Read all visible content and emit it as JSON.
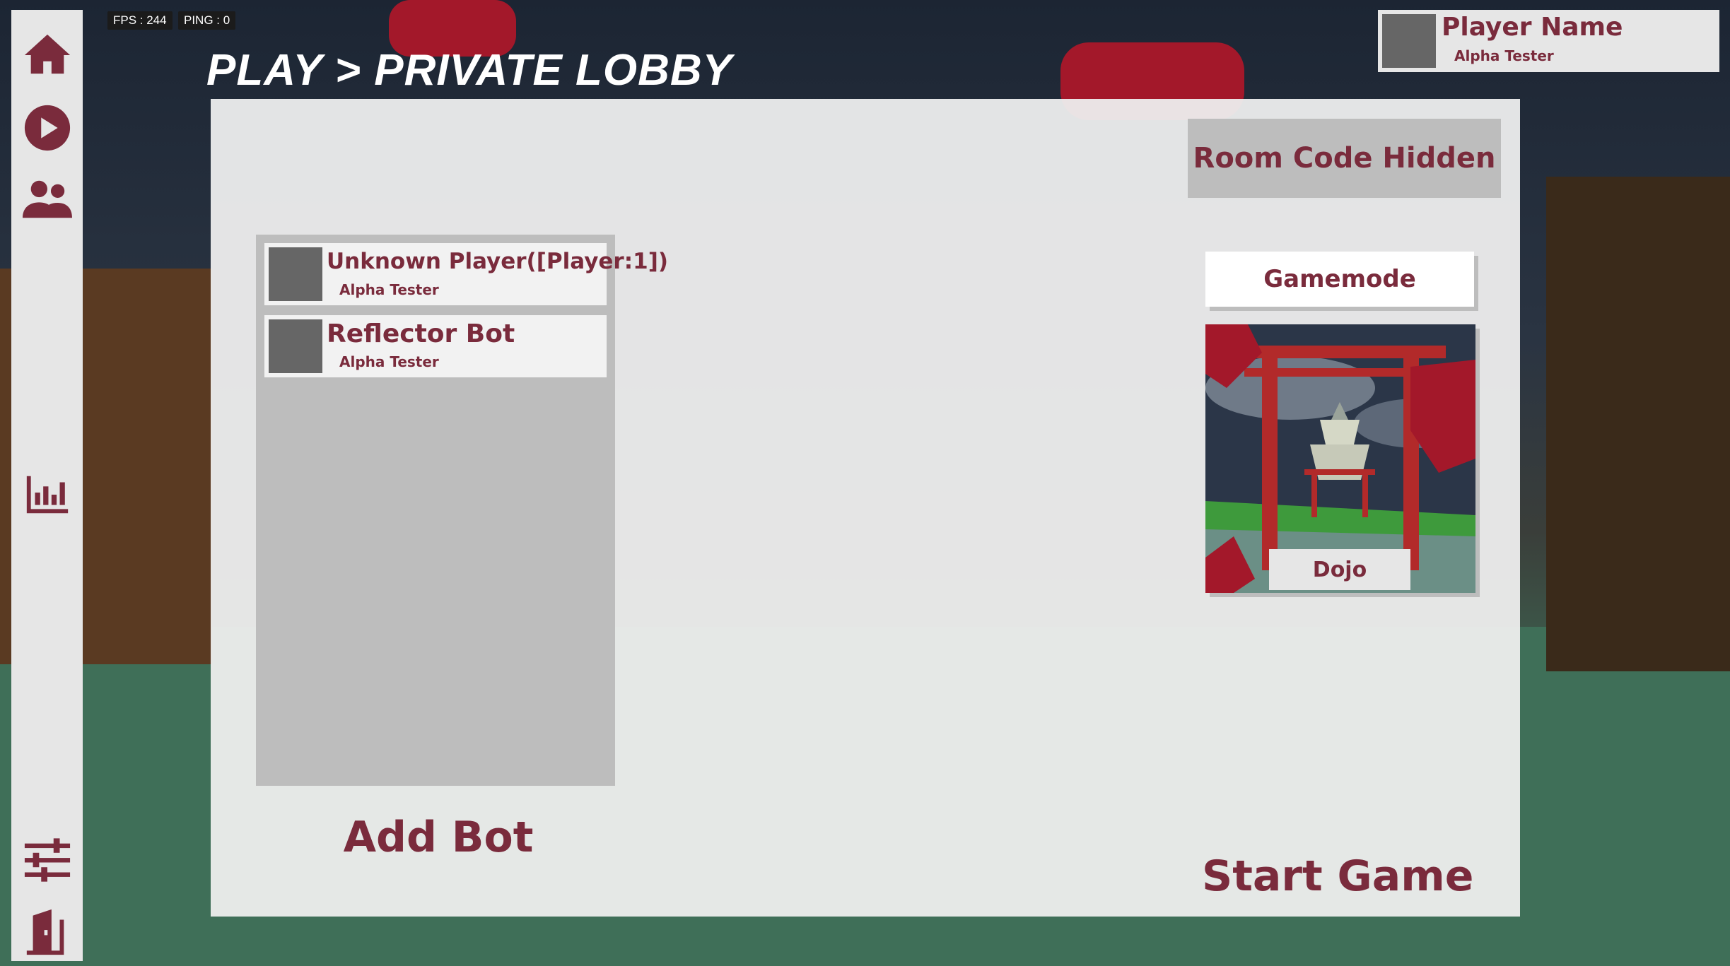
{
  "hud": {
    "fps": "FPS : 244",
    "ping": "PING : 0"
  },
  "breadcrumb": "PLAY > PRIVATE LOBBY",
  "profile": {
    "name": "Player Name",
    "rank": "Alpha Tester"
  },
  "sidebar": {
    "items": [
      {
        "icon": "home-icon"
      },
      {
        "icon": "play-icon"
      },
      {
        "icon": "friends-icon"
      },
      {
        "icon": "stats-icon"
      },
      {
        "icon": "settings-sliders-icon"
      },
      {
        "icon": "exit-door-icon"
      }
    ]
  },
  "lobby": {
    "room_code": "Room Code Hidden",
    "players": [
      {
        "name": "Unknown Player([Player:1])",
        "rank": "Alpha Tester"
      },
      {
        "name": "Reflector Bot",
        "rank": "Alpha Tester"
      }
    ],
    "add_bot": "Add Bot",
    "gamemode": "Gamemode",
    "map_name": "Dojo",
    "start_game": "Start Game"
  },
  "colors": {
    "accent": "#7a2b3c",
    "panel": "#eeeeee",
    "list_bg": "#bdbdbd",
    "avatar": "#666666"
  }
}
